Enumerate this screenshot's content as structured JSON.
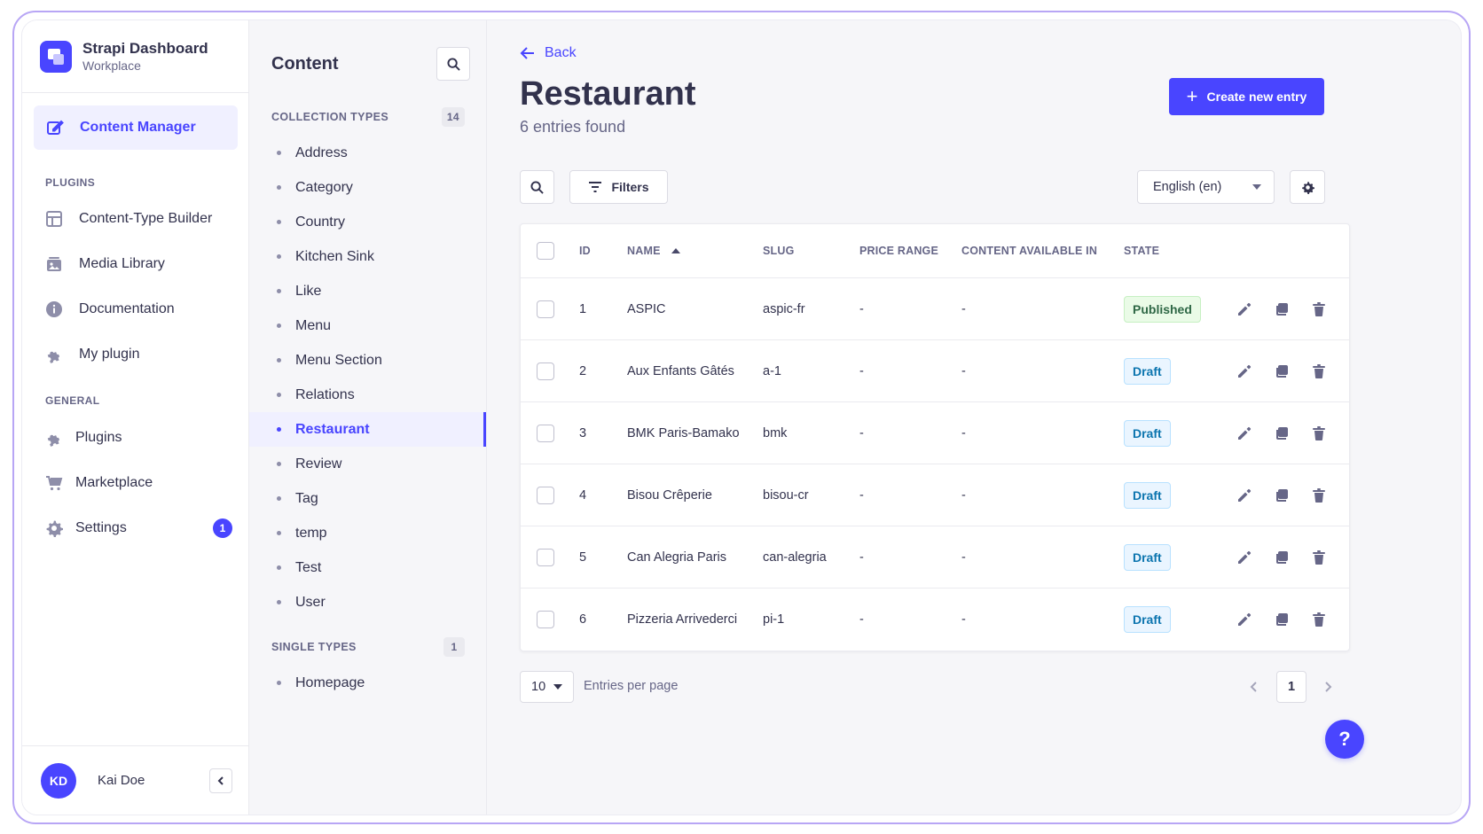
{
  "brand": {
    "title": "Strapi Dashboard",
    "subtitle": "Workplace"
  },
  "mainnav": {
    "active": {
      "label": "Content Manager",
      "icon": "pencil-square-icon"
    },
    "plugins_heading": "PLUGINS",
    "plugins": [
      {
        "label": "Content-Type Builder",
        "icon": "layout-icon"
      },
      {
        "label": "Media Library",
        "icon": "image-icon"
      },
      {
        "label": "Documentation",
        "icon": "info-icon"
      },
      {
        "label": "My plugin",
        "icon": "puzzle-icon"
      }
    ],
    "general_heading": "GENERAL",
    "general": [
      {
        "label": "Plugins",
        "icon": "puzzle-icon"
      },
      {
        "label": "Marketplace",
        "icon": "cart-icon"
      },
      {
        "label": "Settings",
        "icon": "gear-icon",
        "badge": "1"
      }
    ]
  },
  "user": {
    "initials": "KD",
    "name": "Kai Doe"
  },
  "subnav": {
    "title": "Content",
    "collection_heading": "COLLECTION TYPES",
    "collection_count": "14",
    "collection_items": [
      "Address",
      "Category",
      "Country",
      "Kitchen Sink",
      "Like",
      "Menu",
      "Menu Section",
      "Relations",
      "Restaurant",
      "Review",
      "Tag",
      "temp",
      "Test",
      "User"
    ],
    "active_index": 8,
    "single_heading": "SINGLE TYPES",
    "single_count": "1",
    "single_items": [
      "Homepage"
    ]
  },
  "main": {
    "back_label": "Back",
    "title": "Restaurant",
    "subtitle": "6 entries found",
    "create_label": "Create new entry",
    "filters_label": "Filters",
    "locale": "English (en)"
  },
  "table": {
    "headers": {
      "id": "ID",
      "name": "NAME",
      "slug": "SLUG",
      "price": "PRICE RANGE",
      "available": "CONTENT AVAILABLE IN",
      "state": "STATE"
    },
    "rows": [
      {
        "id": "1",
        "name": "ASPIC",
        "slug": "aspic-fr",
        "price": "-",
        "available": "-",
        "state": "Published"
      },
      {
        "id": "2",
        "name": "Aux Enfants Gâtés",
        "slug": "a-1",
        "price": "-",
        "available": "-",
        "state": "Draft"
      },
      {
        "id": "3",
        "name": "BMK Paris-Bamako",
        "slug": "bmk",
        "price": "-",
        "available": "-",
        "state": "Draft"
      },
      {
        "id": "4",
        "name": "Bisou Crêperie",
        "slug": "bisou-cr",
        "price": "-",
        "available": "-",
        "state": "Draft"
      },
      {
        "id": "5",
        "name": "Can Alegria Paris",
        "slug": "can-alegria",
        "price": "-",
        "available": "-",
        "state": "Draft"
      },
      {
        "id": "6",
        "name": "Pizzeria Arrivederci",
        "slug": "pi-1",
        "price": "-",
        "available": "-",
        "state": "Draft"
      }
    ]
  },
  "pagination": {
    "per_page": "10",
    "per_page_label": "Entries per page",
    "current_page": "1"
  },
  "help": {
    "label": "?"
  },
  "colors": {
    "accent": "#4945ff",
    "published": "#2f6846",
    "draft": "#0c75af"
  }
}
